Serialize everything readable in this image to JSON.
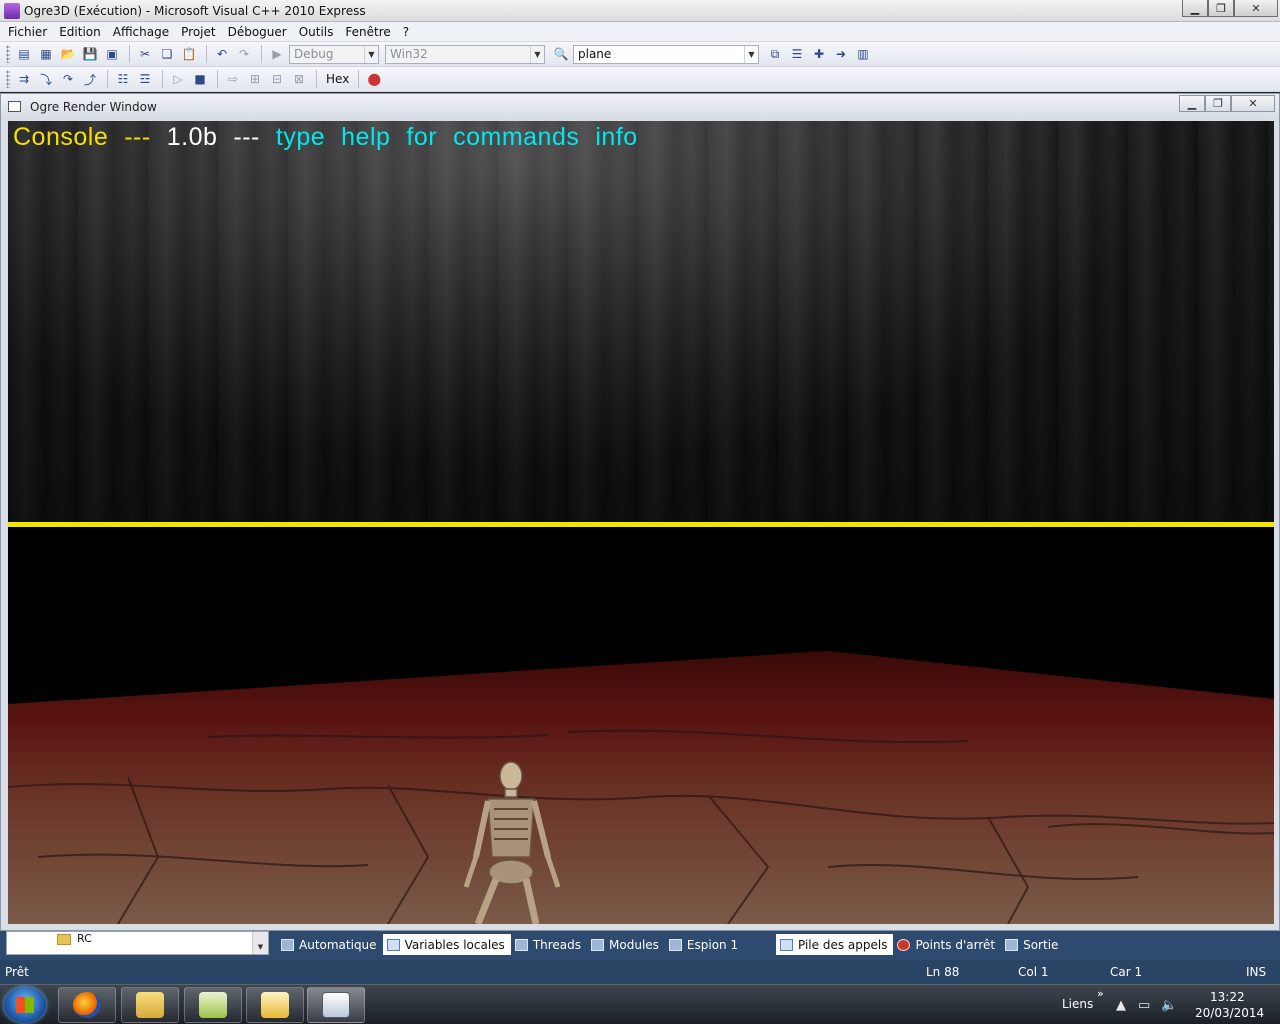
{
  "window": {
    "title": "Ogre3D (Exécution) - Microsoft Visual C++ 2010 Express",
    "controls": {
      "minimize": "▁",
      "maximize": "❐",
      "close": "✕"
    }
  },
  "menu": [
    "Fichier",
    "Edition",
    "Affichage",
    "Projet",
    "Déboguer",
    "Outils",
    "Fenêtre",
    "?"
  ],
  "toolbar": {
    "config_combo": "Debug",
    "platform_combo": "Win32",
    "search_combo": "plane",
    "hex_label": "Hex"
  },
  "render_window": {
    "title": "Ogre Render Window",
    "console": {
      "part1": "Console",
      "part2": "---",
      "part3": "1.0b",
      "part4": "---",
      "part5": "type",
      "part6": "help",
      "part7": "for",
      "part8": "commands",
      "part9": "info"
    }
  },
  "bottom_panel": {
    "left_item": "RC",
    "tabs_left": [
      "Automatique",
      "Variables locales",
      "Threads",
      "Modules",
      "Espion 1"
    ],
    "tabs_right": [
      "Pile des appels",
      "Points d'arrêt",
      "Sortie"
    ]
  },
  "status": {
    "ready": "Prêt",
    "line": "Ln 88",
    "col": "Col 1",
    "char": "Car 1",
    "mode": "INS"
  },
  "taskbar": {
    "links": "Liens",
    "chevron": "»",
    "time": "13:22",
    "date": "20/03/2014"
  },
  "colors": {
    "console_yellow": "#f5e000",
    "console_cyan": "#00e8ee",
    "divider_yellow": "#f2e600",
    "vs_blue": "#2f4a6f"
  }
}
